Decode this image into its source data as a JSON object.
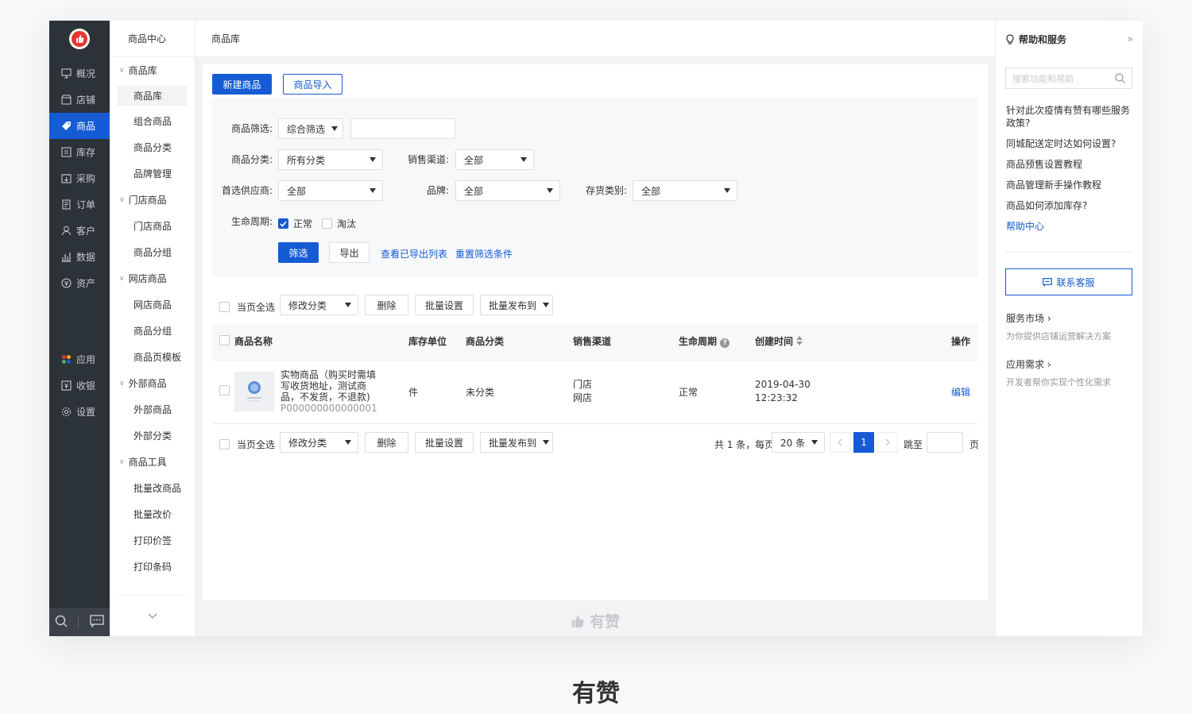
{
  "primary_nav": {
    "items": [
      {
        "label": "概况",
        "icon": "overview-icon"
      },
      {
        "label": "店铺",
        "icon": "shop-icon"
      },
      {
        "label": "商品",
        "icon": "tag-icon",
        "active": true
      },
      {
        "label": "库存",
        "icon": "inventory-icon"
      },
      {
        "label": "采购",
        "icon": "purchase-icon"
      },
      {
        "label": "订单",
        "icon": "order-icon"
      },
      {
        "label": "客户",
        "icon": "customer-icon"
      },
      {
        "label": "数据",
        "icon": "data-icon"
      },
      {
        "label": "资产",
        "icon": "asset-icon"
      }
    ],
    "bottom_items": [
      {
        "label": "应用",
        "icon": "apps-icon"
      },
      {
        "label": "收银",
        "icon": "cashier-icon"
      },
      {
        "label": "设置",
        "icon": "settings-icon"
      }
    ]
  },
  "secondary_nav": {
    "title": "商品中心",
    "groups": [
      {
        "label": "商品库",
        "items": [
          "商品库",
          "组合商品",
          "商品分类",
          "品牌管理"
        ]
      },
      {
        "label": "门店商品",
        "items": [
          "门店商品",
          "商品分组"
        ]
      },
      {
        "label": "网店商品",
        "items": [
          "网店商品",
          "商品分组",
          "商品页模板"
        ]
      },
      {
        "label": "外部商品",
        "items": [
          "外部商品",
          "外部分类"
        ]
      },
      {
        "label": "商品工具",
        "items": [
          "批量改商品",
          "批量改价",
          "打印价签",
          "打印条码"
        ]
      }
    ]
  },
  "breadcrumb": "商品库",
  "toolbar": {
    "new_label": "新建商品",
    "import_label": "商品导入"
  },
  "filter": {
    "product_filter_label": "商品筛选:",
    "product_filter_value": "综合筛选",
    "category_label": "商品分类:",
    "category_value": "所有分类",
    "channel_label": "销售渠道:",
    "channel_value": "全部",
    "supplier_label": "首选供应商:",
    "supplier_value": "全部",
    "brand_label": "品牌:",
    "brand_value": "全部",
    "stock_type_label": "存货类别:",
    "stock_type_value": "全部",
    "lifecycle_label": "生命周期:",
    "lifecycle_normal": "正常",
    "lifecycle_eliminated": "淘汰",
    "filter_button": "筛选",
    "export_button": "导出",
    "view_export_link": "查看已导出列表",
    "reset_link": "重置筛选条件"
  },
  "batch": {
    "select_all": "当页全选",
    "modify_category": "修改分类",
    "delete": "删除",
    "batch_settings": "批量设置",
    "batch_publish": "批量发布到"
  },
  "table": {
    "headers": {
      "name": "商品名称",
      "unit": "库存单位",
      "category": "商品分类",
      "channel": "销售渠道",
      "lifecycle": "生命周期",
      "created": "创建时间",
      "action": "操作"
    },
    "rows": [
      {
        "name_line1": "实物商品（购买时需填",
        "name_line2": "写收货地址，测试商",
        "name_line3": "品，不发货，不退款)",
        "code": "P000000000000001",
        "unit": "件",
        "category": "未分类",
        "channel_1": "门店",
        "channel_2": "网店",
        "lifecycle": "正常",
        "created_date": "2019-04-30",
        "created_time": "12:23:32",
        "action": "编辑"
      }
    ]
  },
  "pagination": {
    "summary": "共 1 条，每页",
    "page_size": "20 条",
    "current_page": "1",
    "jump_label": "跳至",
    "page_suffix": "页"
  },
  "watermark": "有赞",
  "help": {
    "title": "帮助和服务",
    "search_placeholder": "搜索功能和帮助",
    "questions": [
      "针对此次疫情有赞有哪些服务政策?",
      "同城配送定时达如何设置?",
      "商品预售设置教程",
      "商品管理新手操作教程",
      "商品如何添加库存?"
    ],
    "help_center": "帮助中心",
    "contact": "联系客服",
    "service_market_title": "服务市场",
    "service_market_desc": "为你提供店铺运营解决方案",
    "app_demand_title": "应用需求",
    "app_demand_desc": "开发者帮你实现个性化需求"
  },
  "caption": "有赞",
  "colors": {
    "primary": "#155bd4",
    "sidebar": "#2b3238",
    "brand_red": "#e5362f"
  }
}
